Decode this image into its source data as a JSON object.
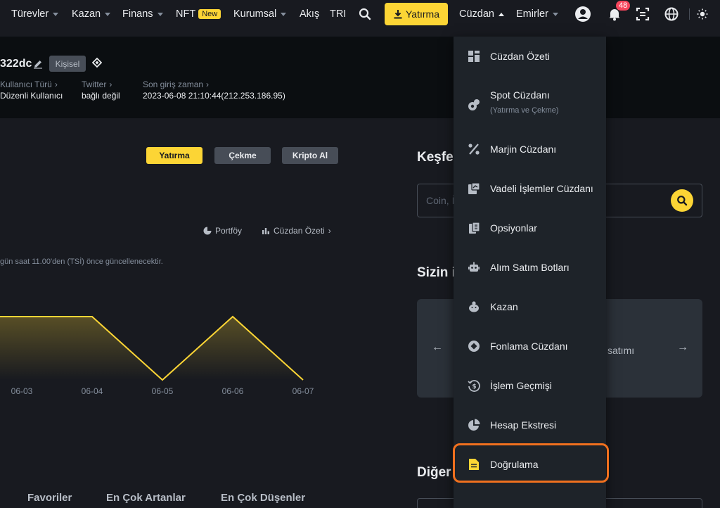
{
  "nav": {
    "items": [
      "Türevler",
      "Kazan",
      "Finans",
      "NFT",
      "Kurumsal",
      "Akış",
      "TRE"
    ],
    "new_badge": "New",
    "deposit": "Yatırma",
    "wallet": "Cüzdan",
    "orders": "Emirler",
    "notification_count": "48"
  },
  "profile": {
    "uid": "322dc",
    "tag": "Kişisel",
    "user_type_label": "Kullanıcı Türü",
    "user_type_value": "Düzenli Kullanıcı",
    "twitter_label": "Twitter",
    "twitter_value": "bağlı değil",
    "last_login_label": "Son giriş zaman",
    "last_login_value": "2023-06-08 21:10:44(212.253.186.95)"
  },
  "left": {
    "deposit": "Yatırma",
    "withdraw": "Çekme",
    "buy_crypto": "Kripto Al",
    "portfolio": "Portföy",
    "wallet_overview": "Cüzdan Özeti",
    "notice": "gün saat 11.00'den (TSİ) önce güncellenecektir."
  },
  "chart_data": {
    "type": "area",
    "x": [
      "06-03",
      "06-04",
      "06-05",
      "06-06",
      "06-07"
    ],
    "series": [
      {
        "values": [
          1,
          1,
          0,
          1,
          0
        ]
      }
    ],
    "color": "#fcd535"
  },
  "tabs": [
    "Favoriler",
    "En Çok Artanlar",
    "En Çok Düşenler"
  ],
  "right": {
    "explore": "Keşfe",
    "search_placeholder": "Coin, İ",
    "yours": "Sizin i",
    "card_text": "satımı",
    "other": "Diğer"
  },
  "dropdown": {
    "items": [
      {
        "label": "Cüzdan Özeti",
        "icon": "grid-icon"
      },
      {
        "label": "Spot Cüzdanı",
        "sub": "(Yatırma ve Çekme)",
        "icon": "spot-icon"
      },
      {
        "label": "Marjin Cüzdanı",
        "icon": "percent-icon"
      },
      {
        "label": "Vadeli İşlemler Cüzdanı",
        "icon": "futures-icon"
      },
      {
        "label": "Opsiyonlar",
        "icon": "options-icon"
      },
      {
        "label": "Alım Satım Botları",
        "icon": "robot-icon"
      },
      {
        "label": "Kazan",
        "icon": "piggy-icon"
      },
      {
        "label": "Fonlama Cüzdanı",
        "icon": "funding-icon"
      },
      {
        "label": "İşlem Geçmişi",
        "icon": "history-icon"
      },
      {
        "label": "Hesap Ekstresi",
        "icon": "pie-icon"
      },
      {
        "label": "Doğrulama",
        "icon": "document-icon"
      }
    ]
  },
  "colors": {
    "accent": "#fcd535",
    "highlight": "#f0701e",
    "background": "#181a20",
    "dropdown": "#1e2329"
  }
}
